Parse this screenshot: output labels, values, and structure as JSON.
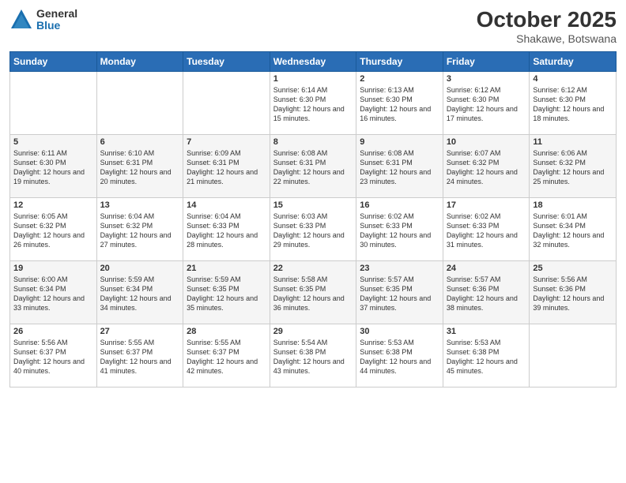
{
  "header": {
    "logo_general": "General",
    "logo_blue": "Blue",
    "month": "October 2025",
    "location": "Shakawe, Botswana"
  },
  "weekdays": [
    "Sunday",
    "Monday",
    "Tuesday",
    "Wednesday",
    "Thursday",
    "Friday",
    "Saturday"
  ],
  "weeks": [
    [
      {
        "day": "",
        "info": ""
      },
      {
        "day": "",
        "info": ""
      },
      {
        "day": "",
        "info": ""
      },
      {
        "day": "1",
        "info": "Sunrise: 6:14 AM\nSunset: 6:30 PM\nDaylight: 12 hours\nand 15 minutes."
      },
      {
        "day": "2",
        "info": "Sunrise: 6:13 AM\nSunset: 6:30 PM\nDaylight: 12 hours\nand 16 minutes."
      },
      {
        "day": "3",
        "info": "Sunrise: 6:12 AM\nSunset: 6:30 PM\nDaylight: 12 hours\nand 17 minutes."
      },
      {
        "day": "4",
        "info": "Sunrise: 6:12 AM\nSunset: 6:30 PM\nDaylight: 12 hours\nand 18 minutes."
      }
    ],
    [
      {
        "day": "5",
        "info": "Sunrise: 6:11 AM\nSunset: 6:30 PM\nDaylight: 12 hours\nand 19 minutes."
      },
      {
        "day": "6",
        "info": "Sunrise: 6:10 AM\nSunset: 6:31 PM\nDaylight: 12 hours\nand 20 minutes."
      },
      {
        "day": "7",
        "info": "Sunrise: 6:09 AM\nSunset: 6:31 PM\nDaylight: 12 hours\nand 21 minutes."
      },
      {
        "day": "8",
        "info": "Sunrise: 6:08 AM\nSunset: 6:31 PM\nDaylight: 12 hours\nand 22 minutes."
      },
      {
        "day": "9",
        "info": "Sunrise: 6:08 AM\nSunset: 6:31 PM\nDaylight: 12 hours\nand 23 minutes."
      },
      {
        "day": "10",
        "info": "Sunrise: 6:07 AM\nSunset: 6:32 PM\nDaylight: 12 hours\nand 24 minutes."
      },
      {
        "day": "11",
        "info": "Sunrise: 6:06 AM\nSunset: 6:32 PM\nDaylight: 12 hours\nand 25 minutes."
      }
    ],
    [
      {
        "day": "12",
        "info": "Sunrise: 6:05 AM\nSunset: 6:32 PM\nDaylight: 12 hours\nand 26 minutes."
      },
      {
        "day": "13",
        "info": "Sunrise: 6:04 AM\nSunset: 6:32 PM\nDaylight: 12 hours\nand 27 minutes."
      },
      {
        "day": "14",
        "info": "Sunrise: 6:04 AM\nSunset: 6:33 PM\nDaylight: 12 hours\nand 28 minutes."
      },
      {
        "day": "15",
        "info": "Sunrise: 6:03 AM\nSunset: 6:33 PM\nDaylight: 12 hours\nand 29 minutes."
      },
      {
        "day": "16",
        "info": "Sunrise: 6:02 AM\nSunset: 6:33 PM\nDaylight: 12 hours\nand 30 minutes."
      },
      {
        "day": "17",
        "info": "Sunrise: 6:02 AM\nSunset: 6:33 PM\nDaylight: 12 hours\nand 31 minutes."
      },
      {
        "day": "18",
        "info": "Sunrise: 6:01 AM\nSunset: 6:34 PM\nDaylight: 12 hours\nand 32 minutes."
      }
    ],
    [
      {
        "day": "19",
        "info": "Sunrise: 6:00 AM\nSunset: 6:34 PM\nDaylight: 12 hours\nand 33 minutes."
      },
      {
        "day": "20",
        "info": "Sunrise: 5:59 AM\nSunset: 6:34 PM\nDaylight: 12 hours\nand 34 minutes."
      },
      {
        "day": "21",
        "info": "Sunrise: 5:59 AM\nSunset: 6:35 PM\nDaylight: 12 hours\nand 35 minutes."
      },
      {
        "day": "22",
        "info": "Sunrise: 5:58 AM\nSunset: 6:35 PM\nDaylight: 12 hours\nand 36 minutes."
      },
      {
        "day": "23",
        "info": "Sunrise: 5:57 AM\nSunset: 6:35 PM\nDaylight: 12 hours\nand 37 minutes."
      },
      {
        "day": "24",
        "info": "Sunrise: 5:57 AM\nSunset: 6:36 PM\nDaylight: 12 hours\nand 38 minutes."
      },
      {
        "day": "25",
        "info": "Sunrise: 5:56 AM\nSunset: 6:36 PM\nDaylight: 12 hours\nand 39 minutes."
      }
    ],
    [
      {
        "day": "26",
        "info": "Sunrise: 5:56 AM\nSunset: 6:37 PM\nDaylight: 12 hours\nand 40 minutes."
      },
      {
        "day": "27",
        "info": "Sunrise: 5:55 AM\nSunset: 6:37 PM\nDaylight: 12 hours\nand 41 minutes."
      },
      {
        "day": "28",
        "info": "Sunrise: 5:55 AM\nSunset: 6:37 PM\nDaylight: 12 hours\nand 42 minutes."
      },
      {
        "day": "29",
        "info": "Sunrise: 5:54 AM\nSunset: 6:38 PM\nDaylight: 12 hours\nand 43 minutes."
      },
      {
        "day": "30",
        "info": "Sunrise: 5:53 AM\nSunset: 6:38 PM\nDaylight: 12 hours\nand 44 minutes."
      },
      {
        "day": "31",
        "info": "Sunrise: 5:53 AM\nSunset: 6:38 PM\nDaylight: 12 hours\nand 45 minutes."
      },
      {
        "day": "",
        "info": ""
      }
    ]
  ]
}
